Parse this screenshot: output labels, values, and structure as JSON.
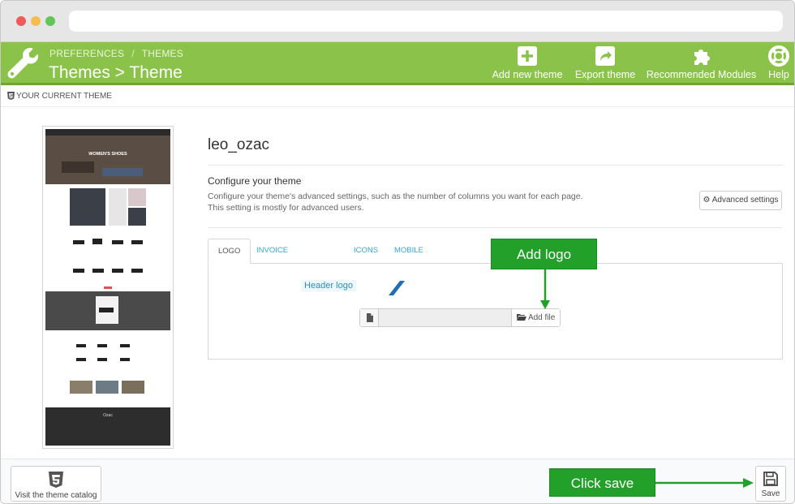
{
  "toolbar": {
    "breadcrumb": [
      "PREFERENCES",
      "THEMES"
    ],
    "breadcrumb_sep": "/",
    "page_title": "Themes > Theme",
    "buttons": [
      {
        "label": "Add new theme",
        "icon": "plus-square-icon"
      },
      {
        "label": "Export theme",
        "icon": "share-icon"
      },
      {
        "label": "Recommended Modules",
        "icon": "puzzle-icon"
      },
      {
        "label": "Help",
        "icon": "lifebuoy-icon"
      }
    ]
  },
  "section": {
    "heading": "YOUR CURRENT THEME"
  },
  "theme": {
    "name": "leo_ozac",
    "configure_title": "Configure your theme",
    "configure_desc": "Configure your theme's advanced settings, such as the number of columns you want for each page. This setting is mostly for advanced users.",
    "advanced_button": "Advanced settings",
    "preview": {
      "banner_text": "WOMEN'S SHOES",
      "footer_brand": "Ozac"
    }
  },
  "tabs": [
    {
      "label": "LOGO",
      "active": true
    },
    {
      "label": "INVOICE & EMAIL LOGOS",
      "active": false
    },
    {
      "label": "ICONS",
      "active": false
    },
    {
      "label": "MOBILE",
      "active": false
    }
  ],
  "logo_panel": {
    "field_label": "Header logo",
    "file_value": "",
    "add_file_label": "Add file"
  },
  "callouts": {
    "add_logo": "Add logo",
    "click_save": "Click save"
  },
  "footer": {
    "catalog_button": "Visit the theme catalog",
    "save_button": "Save"
  },
  "colors": {
    "toolbar_green": "#8bc34a",
    "callout_green": "#22a02a",
    "link_blue": "#2eacce"
  }
}
